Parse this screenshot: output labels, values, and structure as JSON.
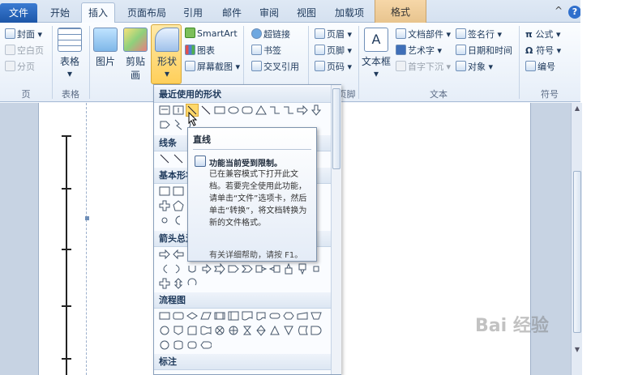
{
  "tabs": [
    "文件",
    "开始",
    "插入",
    "页面布局",
    "引用",
    "邮件",
    "审阅",
    "视图",
    "加载项",
    "格式"
  ],
  "window_controls": {
    "collapse": "^",
    "help": "?"
  },
  "ribbon": {
    "pages": {
      "cover": "封面",
      "blank": "空白页",
      "break": "分页",
      "group": "页"
    },
    "table": {
      "label": "表格",
      "group": "表格"
    },
    "illustrations": {
      "picture": "图片",
      "clipart": "剪贴画",
      "shapes": "形状",
      "smartart": "SmartArt",
      "chart": "图表",
      "screenshot": "屏幕截图"
    },
    "links": {
      "hyperlink": "超链接",
      "bookmark": "书签",
      "crossref": "交叉引用"
    },
    "header_footer": {
      "header": "页眉",
      "footer": "页脚",
      "pagenum": "页码",
      "group": "页眉和页脚"
    },
    "text": {
      "textbox": "文本框",
      "quickparts": "文档部件",
      "wordart": "艺术字",
      "dropcap": "首字下沉",
      "signature": "签名行",
      "datetime": "日期和时间",
      "object": "对象",
      "group": "文本"
    },
    "symbols": {
      "equation": "公式",
      "symbol": "符号",
      "number": "编号",
      "group": "符号"
    }
  },
  "gallery": {
    "sections": [
      "最近使用的形状",
      "线条",
      "基本形状",
      "箭头总汇",
      "流程图",
      "标注"
    ]
  },
  "tooltip": {
    "title": "直线",
    "heading": "功能当前受到限制。",
    "body": "已在兼容模式下打开此文档。若要完全使用此功能，请单击“文件”选项卡，然后单击“转换”，将文档转换为新的文件格式。",
    "footer": "有关详细帮助，请按 F1。"
  },
  "watermark": "Bai 经验"
}
